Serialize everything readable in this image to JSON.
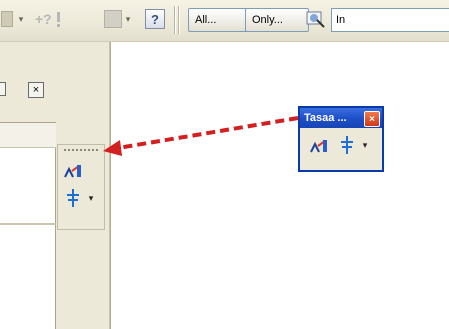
{
  "toolbar": {
    "button_all": "All...",
    "button_only": "Only...",
    "combo_value": "In",
    "help_icon": "?"
  },
  "dock": {
    "close_glyph": "×"
  },
  "floating_toolbar": {
    "title": "Tasaa ...",
    "close_glyph": "×",
    "dropdown_glyph": "▾"
  },
  "docked_toolbar": {
    "dropdown_glyph": "▾"
  },
  "colors": {
    "arrow": "#d21f1f",
    "titlebar": "#1f50c8",
    "toolbar_bg": "#ece9d8"
  },
  "icons": [
    "snap-icon",
    "dimension-icon",
    "help-icon",
    "view-icon",
    "align-icon",
    "distribute-icon"
  ]
}
